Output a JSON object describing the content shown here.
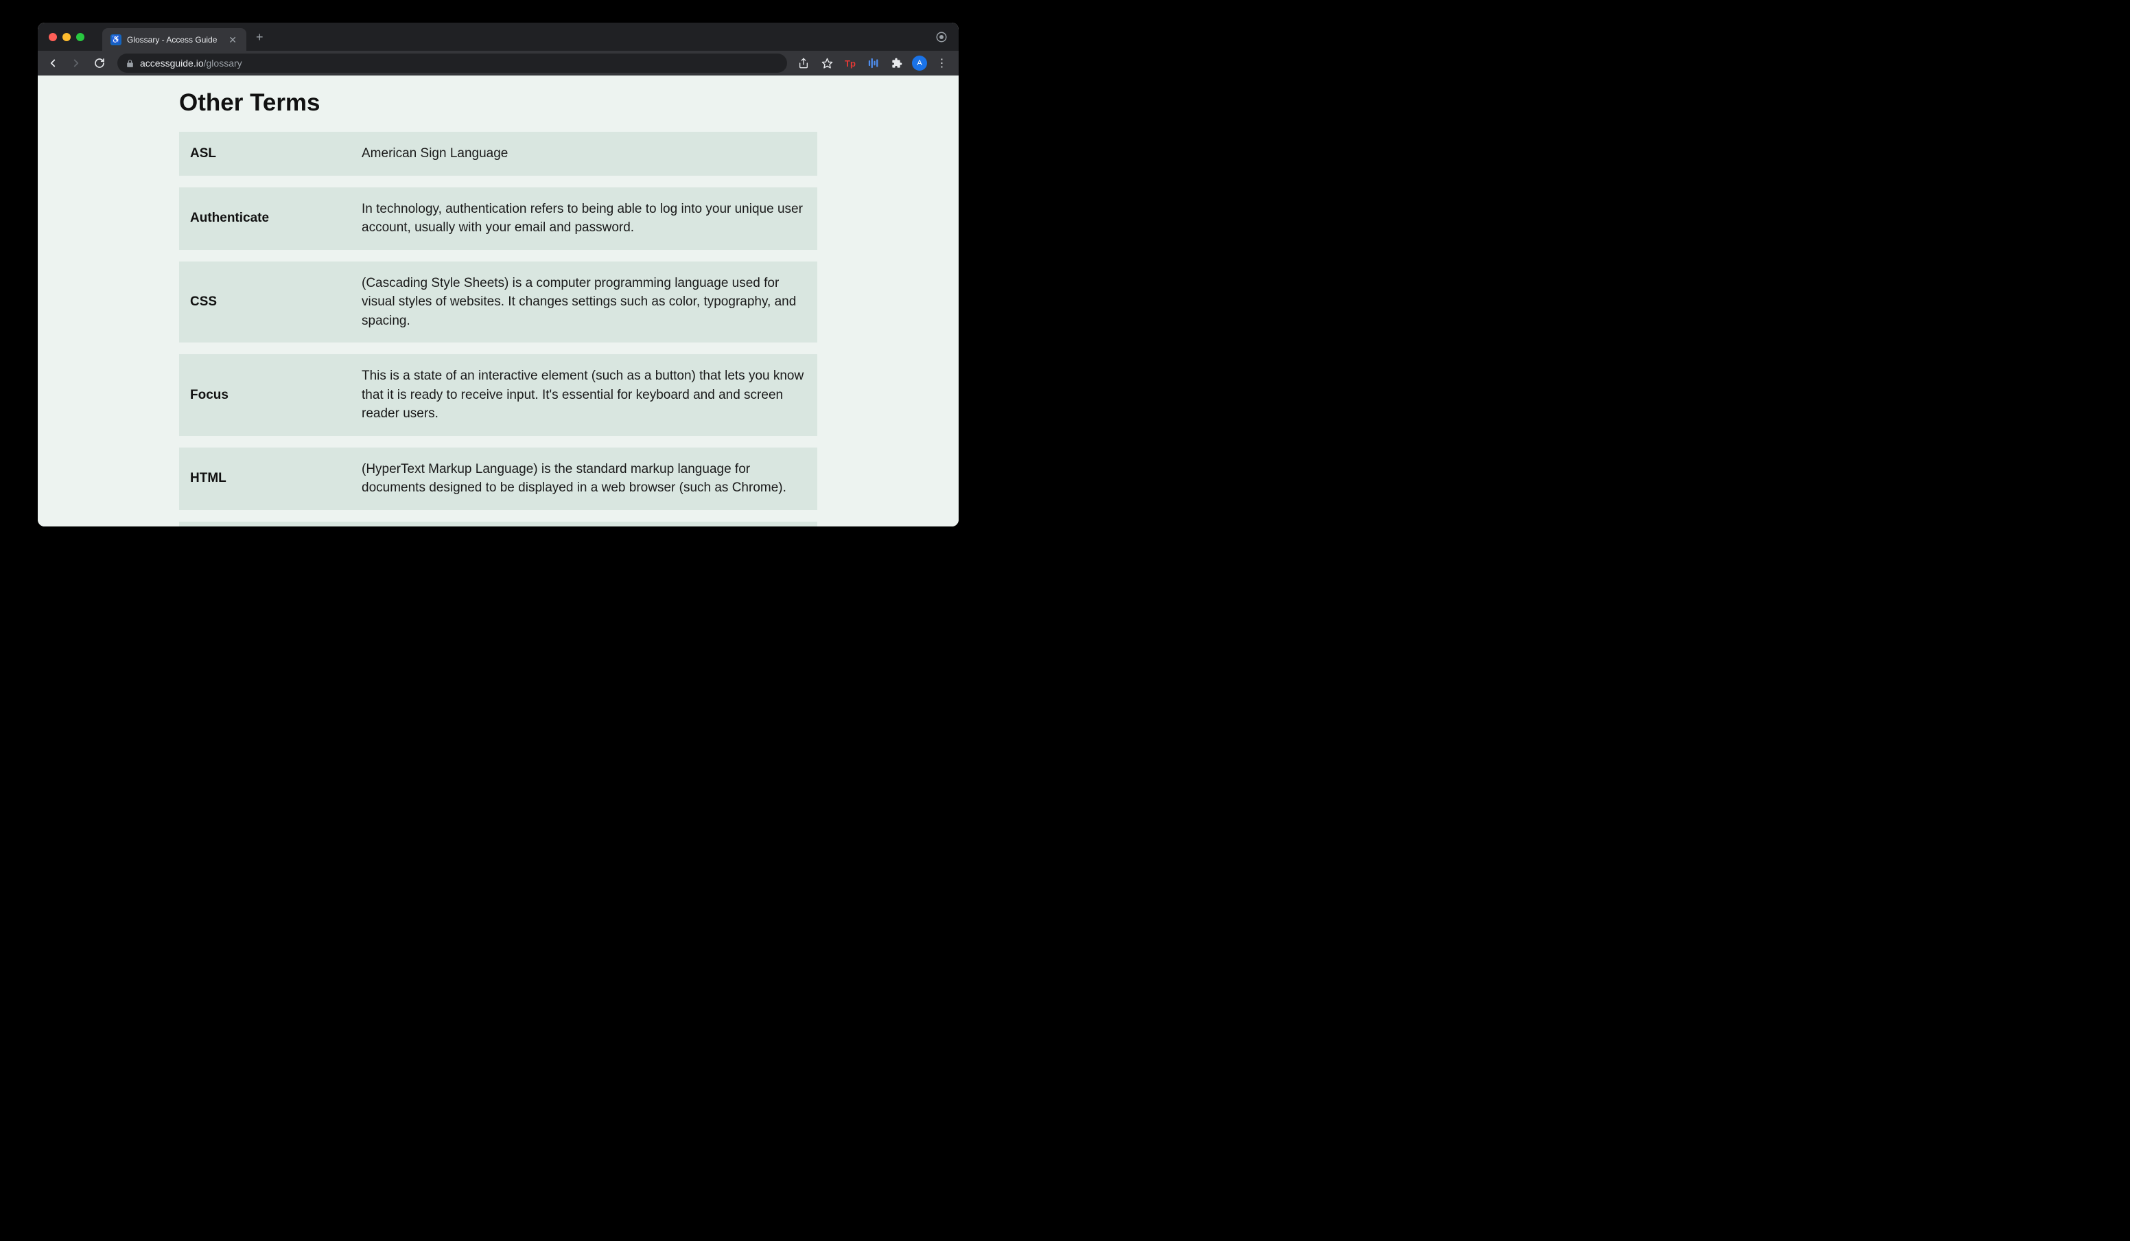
{
  "browser": {
    "tab": {
      "title": "Glossary - Access Guide",
      "favicon_letter": "♿"
    },
    "url": {
      "domain": "accessguide.io",
      "path": "/glossary"
    },
    "avatar_letter": "A",
    "ext_tp": "Tp"
  },
  "page": {
    "heading": "Other Terms",
    "terms": [
      {
        "term": "ASL",
        "definition": "American Sign Language"
      },
      {
        "term": "Authenticate",
        "definition": "In technology, authentication refers to being able to log into your unique user account, usually with your email and password."
      },
      {
        "term": "CSS",
        "definition": "(Cascading Style Sheets) is a computer programming language used for visual styles of websites. It changes settings such as color, typography, and spacing."
      },
      {
        "term": "Focus",
        "definition": "This is a state of an interactive element (such as a button) that lets you know that it is ready to receive input. It's essential for keyboard and and screen reader users."
      },
      {
        "term": "HTML",
        "definition": "(HyperText Markup Language) is the standard markup language for documents designed to be displayed in a web browser (such as Chrome)."
      }
    ]
  }
}
